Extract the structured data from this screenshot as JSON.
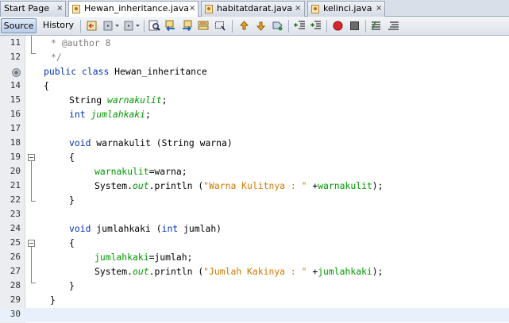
{
  "tabs": [
    {
      "label": "Start Page",
      "active": false
    },
    {
      "label": "Hewan_inheritance.java",
      "active": true
    },
    {
      "label": "habitatdarat.java",
      "active": false
    },
    {
      "label": "kelinci.java",
      "active": false
    }
  ],
  "close_glyph": "×",
  "toolbar": {
    "source_label": "Source",
    "history_label": "History"
  },
  "lines": [
    {
      "num": "11",
      "text": "* @author 8"
    },
    {
      "num": "12",
      "text": "*/"
    },
    {
      "num": "13",
      "text": "public class Hewan_inheritance"
    },
    {
      "num": "14",
      "text": "{"
    },
    {
      "num": "15",
      "text": "String warnakulit;"
    },
    {
      "num": "16",
      "text": "int jumlahkaki;"
    },
    {
      "num": "17",
      "text": ""
    },
    {
      "num": "18",
      "text": "void warnakulit (String warna)"
    },
    {
      "num": "19",
      "text": "{"
    },
    {
      "num": "20",
      "text": "warnakulit=warna;"
    },
    {
      "num": "21",
      "text": "System.out.println (\"Warna Kulitnya : \" +warnakulit);"
    },
    {
      "num": "22",
      "text": "}"
    },
    {
      "num": "23",
      "text": ""
    },
    {
      "num": "24",
      "text": ""
    },
    {
      "num": "25",
      "text": "void jumlahkaki (int jumlah)"
    },
    {
      "num": "26",
      "text": "{"
    },
    {
      "num": "27",
      "text": "jumlahkaki=jumlah;"
    },
    {
      "num": "28",
      "text": "System.out.println (\"Jumlah Kakinya : \" +jumlahkaki);"
    },
    {
      "num": "29",
      "text": "}"
    },
    {
      "num": "30",
      "text": "}"
    }
  ],
  "tokens": {
    "l11": "* @author 8",
    "l12": "*/",
    "l13_kw1": "public",
    "l13_kw2": "class",
    "l13_name": "Hewan_inheritance",
    "l14": "{",
    "l15_type": "String",
    "l15_field": "warnakulit",
    "l15_end": ";",
    "l16_type": "int",
    "l16_field": "jumlahkaki",
    "l16_end": ";",
    "l18_kw": "void",
    "l18_rest": "warnakulit (String warna)",
    "l19": "{",
    "l20_field": "warnakulit",
    "l20_rest": "=warna;",
    "l21_a": "System.",
    "l21_out": "out",
    "l21_b": ".println (",
    "l21_str": "\"Warna Kulitnya : \"",
    "l21_c": " +",
    "l21_field": "warnakulit",
    "l21_d": ");",
    "l22": "}",
    "l25_kw": "void",
    "l25_mid": "jumlahkaki (",
    "l25_kw2": "int",
    "l25_rest": "jumlah)",
    "l26": "{",
    "l27_field": "jumlahkaki",
    "l27_rest": "=jumlah;",
    "l28_a": "System.",
    "l28_out": "out",
    "l28_b": ".println (",
    "l28_str": "\"Jumlah Kakinya : \"",
    "l28_c": " +",
    "l28_field": "jumlahkaki",
    "l28_d": ");",
    "l29": "}",
    "l30": "}"
  },
  "colors": {
    "keyword": "#0033b3",
    "field": "#009900",
    "string": "#ce7b00",
    "comment": "#808080",
    "current_line": "#e8f0fb"
  },
  "icons": [
    "java-file-icon",
    "back-icon",
    "forward-icon",
    "find-icon",
    "find-previous-icon",
    "find-next-icon",
    "toggle-highlight-icon",
    "find-selection-icon",
    "previous-bookmark-icon",
    "next-bookmark-icon",
    "toggle-bookmark-icon",
    "shift-left-icon",
    "shift-right-icon",
    "record-macro-icon",
    "stop-macro-icon",
    "comment-icon",
    "uncomment-icon"
  ]
}
